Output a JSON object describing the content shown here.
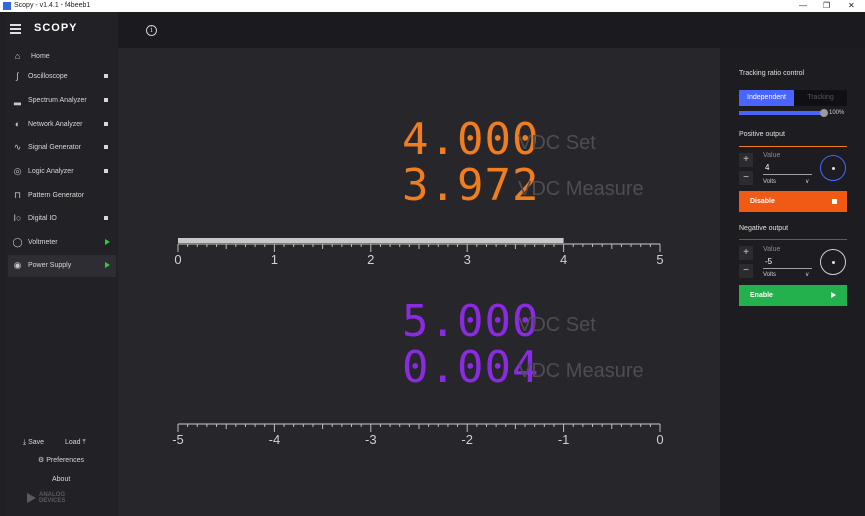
{
  "window": {
    "title": "Scopy - v1.4.1 - f4beeb1",
    "minimize_glyph": "—",
    "maximize_glyph": "❐",
    "close_glyph": "✕"
  },
  "sidebar": {
    "logo": "SCOPY",
    "home_label": "Home",
    "items": [
      {
        "label": "Oscilloscope",
        "icon": "oscilloscope-icon"
      },
      {
        "label": "Spectrum Analyzer",
        "icon": "spectrum-icon"
      },
      {
        "label": "Network Analyzer",
        "icon": "network-icon"
      },
      {
        "label": "Signal Generator",
        "icon": "signal-icon"
      },
      {
        "label": "Logic Analyzer",
        "icon": "logic-icon"
      },
      {
        "label": "Pattern Generator",
        "icon": "pattern-icon"
      },
      {
        "label": "Digital IO",
        "icon": "digital-io-icon"
      },
      {
        "label": "Voltmeter",
        "icon": "voltmeter-icon"
      },
      {
        "label": "Power Supply",
        "icon": "power-supply-icon"
      }
    ],
    "save_label": "Save",
    "load_label": "Load",
    "preferences_label": "Preferences",
    "about_label": "About",
    "brand_line1": "ANALOG",
    "brand_line2": "DEVICES"
  },
  "display": {
    "positive_set_value": "4.000",
    "positive_set_unit": "VDC  Set",
    "positive_measure_value": "3.972",
    "positive_measure_unit": "VDC  Measure",
    "negative_set_value": "5.000",
    "negative_set_unit": "VDC  Set",
    "negative_measure_value": "0.004",
    "negative_measure_unit": "VDC  Measure",
    "positive_scale_ticks": [
      "0",
      "1",
      "2",
      "3",
      "4",
      "5"
    ],
    "positive_scale_fill_fraction": 0.8,
    "negative_scale_ticks": [
      "-5",
      "-4",
      "-3",
      "-2",
      "-1",
      "0"
    ]
  },
  "controls": {
    "tracking_title": "Tracking ratio control",
    "independent_label": "Independent",
    "tracking_label": "Tracking",
    "ratio_percent": "100%",
    "ratio_fraction": 1.0,
    "positive_title": "Positive output",
    "positive_value_label": "Value",
    "positive_value": "4",
    "positive_unit": "Volts",
    "positive_button": "Disable",
    "negative_title": "Negative output",
    "negative_value_label": "Value",
    "negative_value": "-5",
    "negative_unit": "Volts",
    "negative_button": "Enable"
  },
  "colors": {
    "positive": "#f07d1e",
    "negative": "#8a2be2",
    "accent_blue": "#4a64ff",
    "disable_button": "#f05a14",
    "enable_button": "#22b14c"
  }
}
